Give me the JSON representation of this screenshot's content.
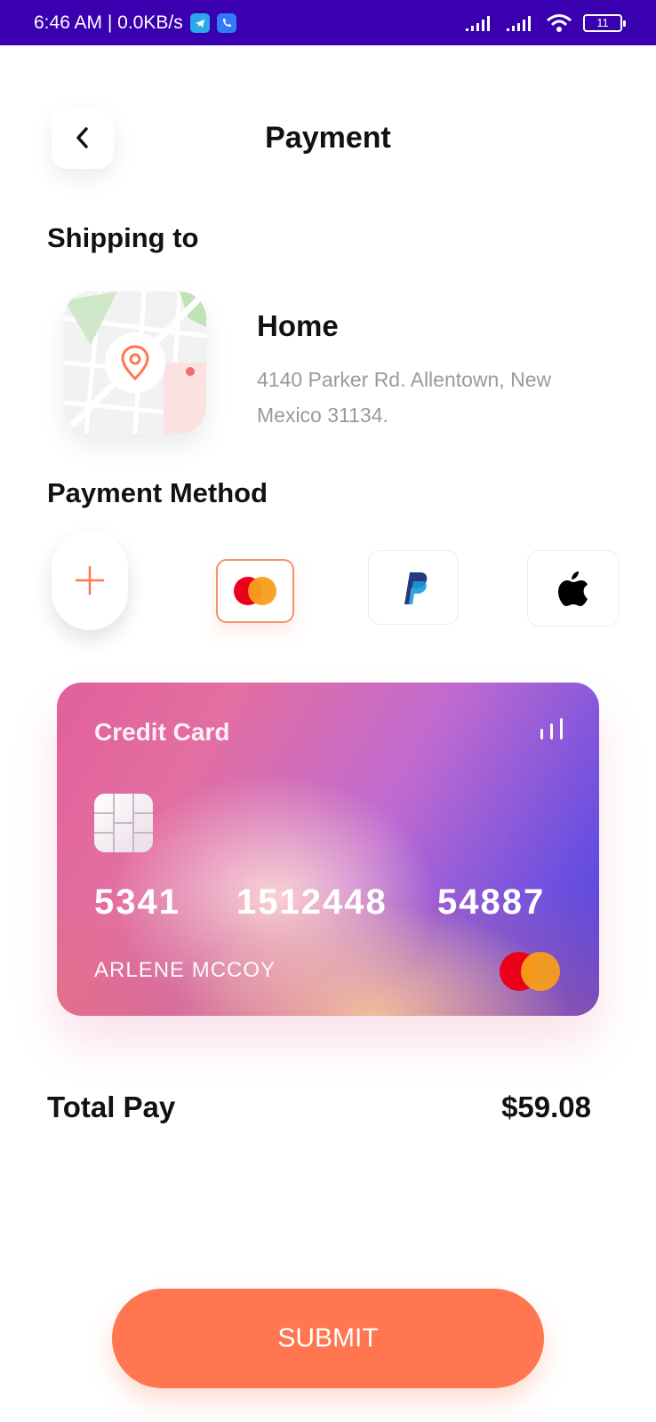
{
  "status_bar": {
    "time_speed": "6:46 AM | 0.0KB/s",
    "battery": "11"
  },
  "header": {
    "title": "Payment"
  },
  "shipping": {
    "section_title": "Shipping to",
    "place_name": "Home",
    "address": "4140 Parker Rd. Allentown, New Mexico 31134."
  },
  "payment_method": {
    "section_title": "Payment Method",
    "options": [
      "add",
      "mastercard",
      "paypal",
      "apple-pay"
    ],
    "selected": "mastercard"
  },
  "card": {
    "label": "Credit Card",
    "number_groups": [
      "5341",
      "1512448",
      "54887"
    ],
    "holder": "ARLENE MCCOY",
    "brand": "mastercard"
  },
  "total": {
    "label": "Total Pay",
    "value": "$59.08"
  },
  "submit_label": "SUBMIT",
  "colors": {
    "accent": "#ff7650",
    "status_bar": "#3a00b0",
    "paypal_dark": "#253b80",
    "paypal_light": "#179bd7"
  }
}
